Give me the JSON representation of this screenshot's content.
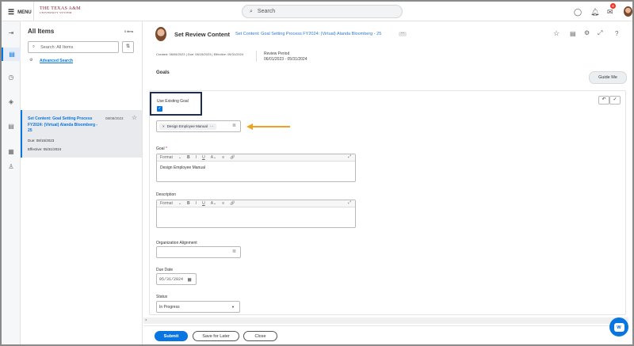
{
  "header": {
    "menu_label": "MENU",
    "logo_line1": "THE TEXAS A&M",
    "logo_line2": "UNIVERSITY SYSTEM",
    "search_placeholder": "Search",
    "notification_count": "6"
  },
  "list": {
    "title": "All Items",
    "count": "5 items",
    "search_placeholder": "Search: All Items",
    "advanced_search": "Advanced Search",
    "items": [
      {
        "title": "Set Content: Goal Setting Process FY2024: (Virtual) Alanda Bloomberg - 25",
        "date": "08/08/2023",
        "due": "Due: 08/15/2023",
        "effective": "Effective: 05/31/2024"
      }
    ]
  },
  "main": {
    "title": "Set Review Content",
    "subtitle": "Set Content: Goal Setting Process FY2024: (Virtual) Alanda Bloomberg - 25",
    "meta": "Created: 08/08/2023 | Due: 08/15/2023 | Effective: 05/31/2024",
    "review_period_label": "Review Period",
    "review_period": "06/01/2023 - 05/31/2024",
    "section": "Goals",
    "guide_me": "Guide Me"
  },
  "form": {
    "use_existing_label": "Use Existing Goal",
    "use_existing_checked": true,
    "selected_goal": "Design Employee Manual",
    "goal_label": "Goal",
    "required_mark": "*",
    "goal_value": "Design Employee Manual",
    "format_label": "Format",
    "description_label": "Description",
    "description_value": "",
    "org_alignment_label": "Organization Alignment",
    "due_date_label": "Due Date",
    "due_date": "05/31/2024",
    "status_label": "Status",
    "status": "In Progress"
  },
  "footer": {
    "submit": "Submit",
    "save_later": "Save for Later",
    "close": "Close"
  },
  "colors": {
    "accent": "#0875e1",
    "arrow": "#f0a21e",
    "highlight_box": "#1f2d4d"
  }
}
